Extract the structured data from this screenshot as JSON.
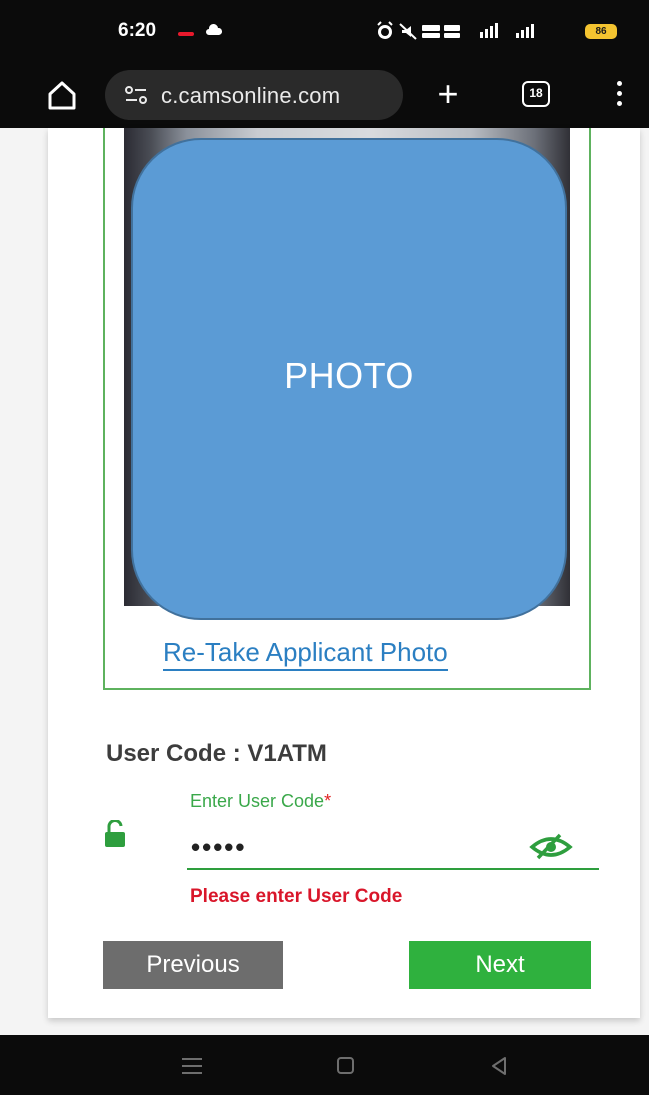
{
  "status_bar": {
    "time": "6:20",
    "battery": "86"
  },
  "browser": {
    "url": "c.camsonline.com",
    "tab_count": "18"
  },
  "photo": {
    "placeholder_label": "PHOTO",
    "retake_label": "Re-Take Applicant Photo"
  },
  "form": {
    "user_code_label": "User Code : V1ATM",
    "field_label": "Enter User Code",
    "required_mark": "*",
    "field_value": "•••••",
    "error_message": "Please enter User Code"
  },
  "actions": {
    "previous_label": "Previous",
    "next_label": "Next"
  },
  "colors": {
    "accent_green": "#2fb13e",
    "error_red": "#d9162a",
    "link_blue": "#2b7fc2",
    "placeholder_blue": "#5b9bd5"
  },
  "icons": {
    "status": [
      "alarm-icon",
      "signal-icon",
      "battery-icon"
    ],
    "browser": [
      "home-icon",
      "site-settings-icon",
      "add-tab-icon",
      "tab-switcher-icon",
      "more-vert-icon"
    ],
    "form": [
      "unlock-icon",
      "visibility-icon"
    ],
    "nav": [
      "recent-apps-icon",
      "home-nav-icon",
      "back-icon"
    ]
  }
}
